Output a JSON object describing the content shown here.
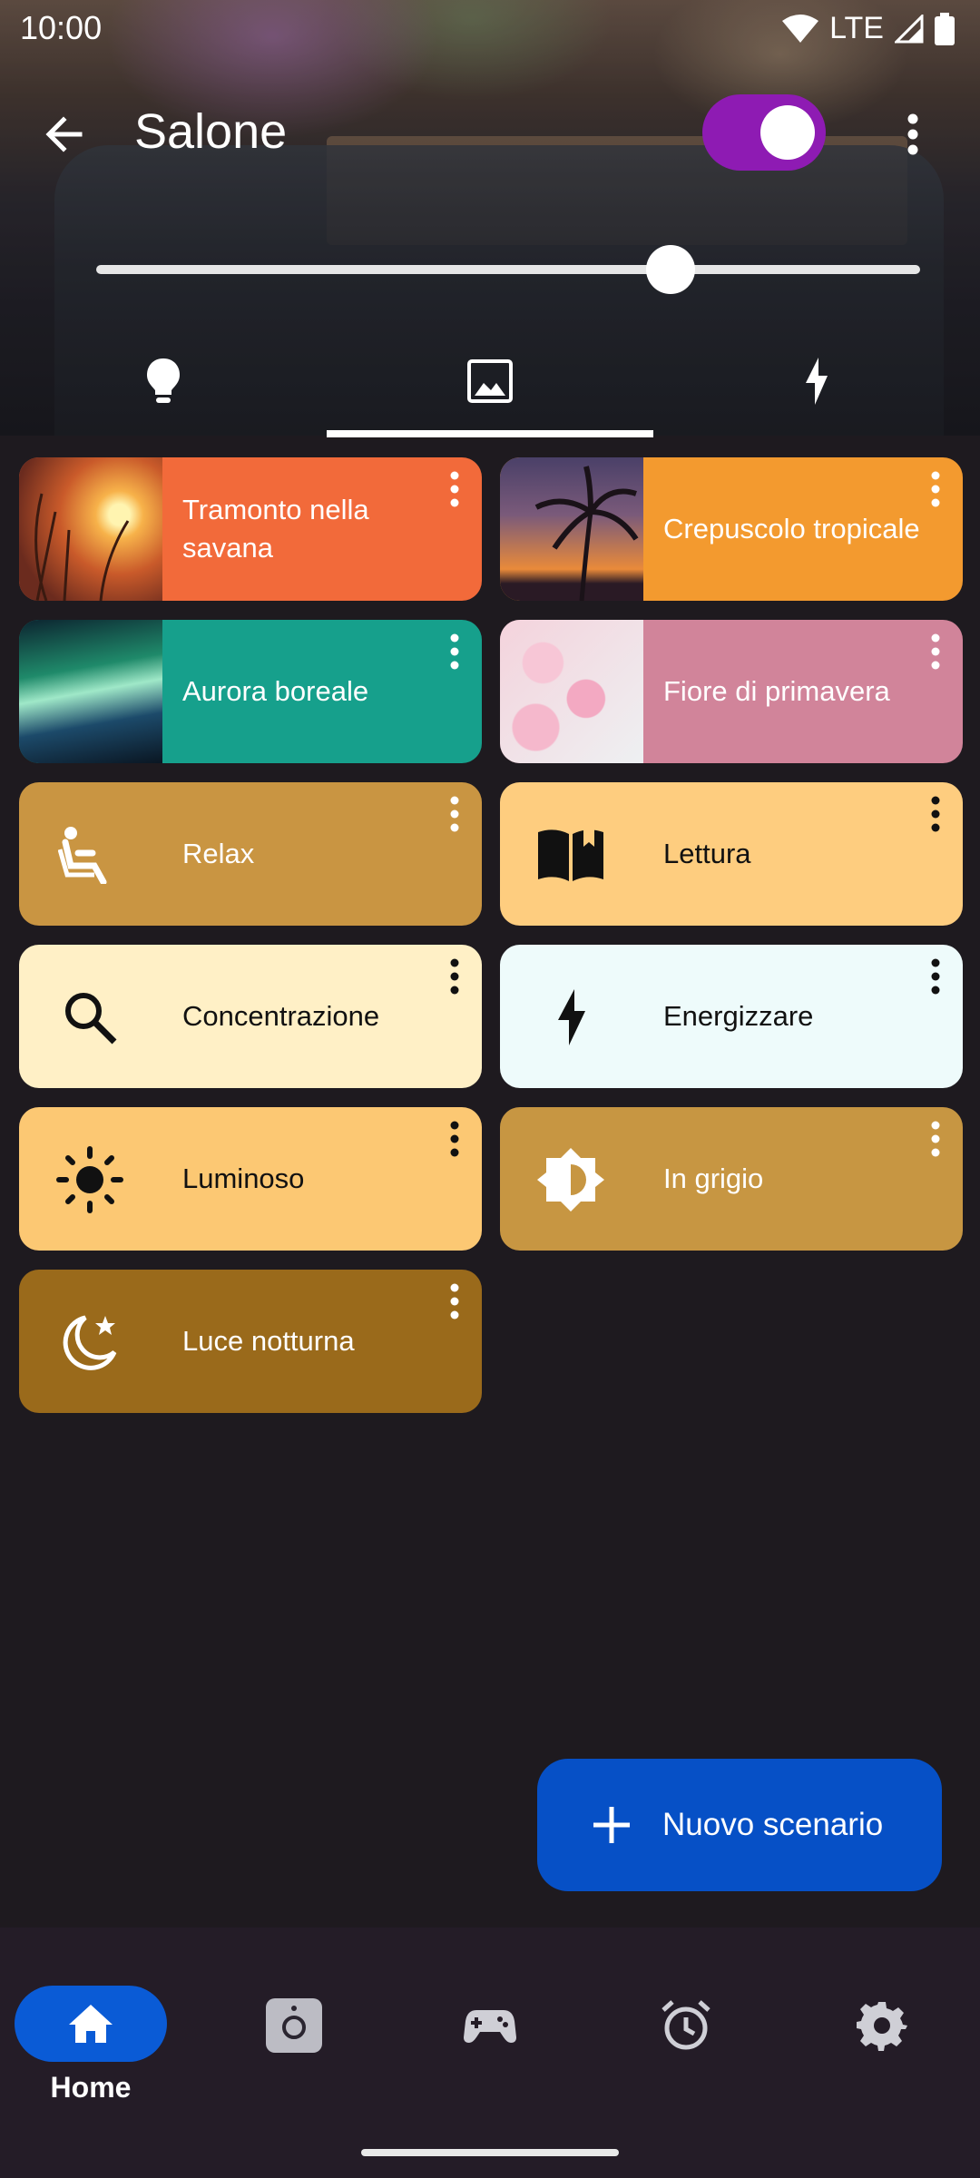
{
  "status_bar": {
    "time": "10:00",
    "network": "LTE"
  },
  "header": {
    "title": "Salone",
    "power_on": true,
    "brightness_percent": 68
  },
  "tabs": [
    {
      "icon": "lightbulb-icon"
    },
    {
      "icon": "image-icon",
      "selected": true
    },
    {
      "icon": "flash-icon"
    }
  ],
  "scenes": [
    {
      "label": "Tramonto nella savana",
      "color": "#f26a3a",
      "thumb": "sunset-grass-photo"
    },
    {
      "label": "Crepuscolo tropicale",
      "color": "#f39a2f",
      "thumb": "palm-sunset-photo"
    },
    {
      "label": "Aurora boreale",
      "color": "#16a08c",
      "thumb": "aurora-photo"
    },
    {
      "label": "Fiore di primavera",
      "color": "#d1849a",
      "thumb": "cherry-blossom-photo"
    },
    {
      "label": "Relax",
      "color": "#c99542",
      "icon": "recline-icon"
    },
    {
      "label": "Lettura",
      "color": "#fecd7f",
      "icon": "book-icon"
    },
    {
      "label": "Concentrazione",
      "color": "#fff0c6",
      "icon": "search-icon"
    },
    {
      "label": "Energizzare",
      "color": "#eefbfb",
      "icon": "bolt-icon"
    },
    {
      "label": "Luminoso",
      "color": "#fcc873",
      "icon": "sun-icon"
    },
    {
      "label": "In grigio",
      "color": "#c79642",
      "icon": "brightness-icon"
    },
    {
      "label": "Luce notturna",
      "color": "#9a6a1b",
      "icon": "night-icon"
    }
  ],
  "fab": {
    "label": "Nuovo scenario"
  },
  "bottom_nav": [
    {
      "label": "Home",
      "icon": "home-icon",
      "selected": true
    },
    {
      "label": "",
      "icon": "camera-box-icon"
    },
    {
      "label": "",
      "icon": "gamepad-icon"
    },
    {
      "label": "",
      "icon": "alarm-icon"
    },
    {
      "label": "",
      "icon": "gear-icon"
    }
  ]
}
